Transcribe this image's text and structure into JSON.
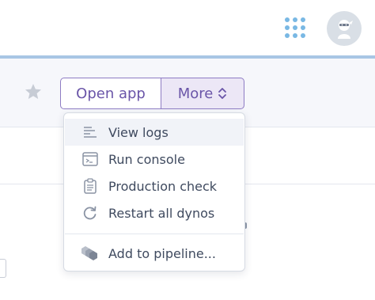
{
  "header": {
    "apps_icon": "grid-icon",
    "avatar_icon": "ninja-avatar"
  },
  "colors": {
    "accent": "#79589f",
    "accent_light": "#ece7f6",
    "grid_blue": "#79b8e4",
    "rule_blue": "#a8c6e4"
  },
  "actions": {
    "open_app_label": "Open app",
    "more_label": "More",
    "favorite_icon": "star-icon",
    "more_icon": "chevron-up-down-icon"
  },
  "menu": {
    "items": [
      {
        "label": "View logs",
        "icon": "logs-icon"
      },
      {
        "label": "Run console",
        "icon": "console-icon"
      },
      {
        "label": "Production check",
        "icon": "clipboard-icon"
      },
      {
        "label": "Restart all dynos",
        "icon": "restart-icon"
      },
      {
        "label": "Add to pipeline...",
        "icon": "pipeline-icon"
      }
    ]
  }
}
